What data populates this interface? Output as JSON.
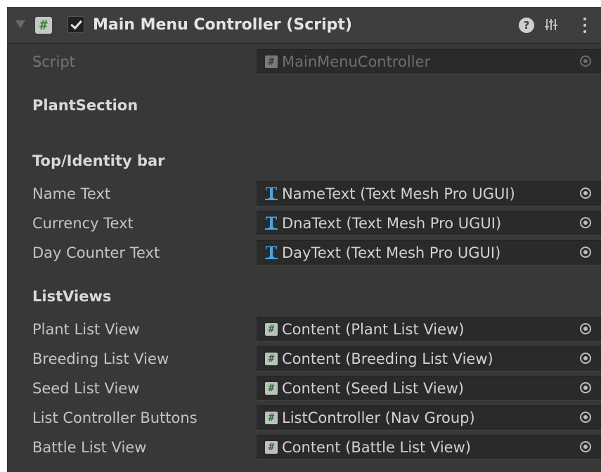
{
  "component": {
    "title": "Main Menu Controller (Script)",
    "enabled": true
  },
  "script_row": {
    "label": "Script",
    "value": "MainMenuController",
    "icon": "script-icon"
  },
  "sections": {
    "plant": "PlantSection",
    "top_bar": "Top/Identity bar",
    "list_views": "ListViews"
  },
  "top_bar_fields": [
    {
      "label": "Name Text",
      "value": "NameText (Text Mesh Pro UGUI)",
      "icon": "text-mesh-pro-icon"
    },
    {
      "label": "Currency Text",
      "value": "DnaText (Text Mesh Pro UGUI)",
      "icon": "text-mesh-pro-icon"
    },
    {
      "label": "Day Counter Text",
      "value": "DayText (Text Mesh Pro UGUI)",
      "icon": "text-mesh-pro-icon"
    }
  ],
  "list_view_fields": [
    {
      "label": "Plant List View",
      "value": "Content (Plant List View)",
      "icon": "script-icon"
    },
    {
      "label": "Breeding List View",
      "value": "Content (Breeding List View)",
      "icon": "script-icon"
    },
    {
      "label": "Seed List View",
      "value": "Content (Seed List View)",
      "icon": "script-icon"
    },
    {
      "label": "List Controller Buttons",
      "value": "ListController (Nav Group)",
      "icon": "script-icon"
    },
    {
      "label": "Battle List View",
      "value": "Content (Battle List View)",
      "icon": "script-icon"
    }
  ],
  "header_icons": {
    "help": "?",
    "presets": "presets-icon",
    "menu": "kebab-menu-icon"
  },
  "colors": {
    "panel_bg": "#383838",
    "field_bg": "#2a2a2a",
    "tmp_icon": "#4aa3df",
    "script_icon_hash": "#3a8a3a"
  }
}
